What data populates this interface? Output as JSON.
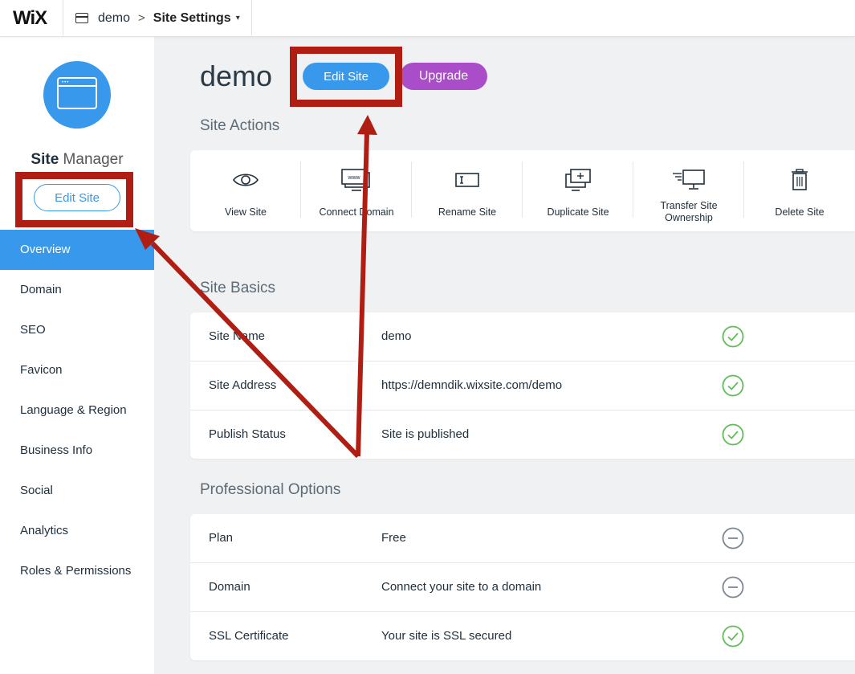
{
  "topbar": {
    "logo": "WiX",
    "breadcrumb_site": "demo",
    "breadcrumb_sep": ">",
    "breadcrumb_current": "Site Settings",
    "caret": "▾"
  },
  "sidebar": {
    "title_bold": "Site",
    "title_light": " Manager",
    "edit_button": "Edit Site",
    "nav": [
      {
        "label": "Overview",
        "active": true
      },
      {
        "label": "Domain"
      },
      {
        "label": "SEO"
      },
      {
        "label": "Favicon"
      },
      {
        "label": "Language & Region"
      },
      {
        "label": "Business Info"
      },
      {
        "label": "Social"
      },
      {
        "label": "Analytics"
      },
      {
        "label": "Roles & Permissions"
      }
    ]
  },
  "main": {
    "title": "demo",
    "edit_button": "Edit Site",
    "upgrade_button": "Upgrade",
    "site_actions": {
      "title": "Site Actions",
      "items": [
        {
          "label": "View Site",
          "icon": "eye-icon"
        },
        {
          "label": "Connect Domain",
          "icon": "www-monitor-icon"
        },
        {
          "label": "Rename Site",
          "icon": "rename-icon"
        },
        {
          "label": "Duplicate Site",
          "icon": "duplicate-icon"
        },
        {
          "label_line1": "Transfer Site",
          "label_line2": "Ownership",
          "icon": "transfer-icon"
        },
        {
          "label": "Delete Site",
          "icon": "trash-icon"
        }
      ]
    },
    "site_basics": {
      "title": "Site Basics",
      "rows": [
        {
          "key": "Site Name",
          "value": "demo",
          "status": "check"
        },
        {
          "key": "Site Address",
          "value": "https://demndik.wixsite.com/demo",
          "status": "check"
        },
        {
          "key": "Publish Status",
          "value": "Site is published",
          "status": "check"
        }
      ]
    },
    "professional_options": {
      "title": "Professional Options",
      "rows": [
        {
          "key": "Plan",
          "value": "Free",
          "status": "minus"
        },
        {
          "key": "Domain",
          "value": "Connect your site to a domain",
          "status": "minus"
        },
        {
          "key": "SSL Certificate",
          "value": "Your site is SSL secured",
          "status": "check"
        }
      ]
    }
  },
  "colors": {
    "accent": "#3899ec",
    "upgrade": "#aa4dc8",
    "check": "#60bc57",
    "neutral": "#7a8793",
    "annotation": "#b01d12"
  }
}
